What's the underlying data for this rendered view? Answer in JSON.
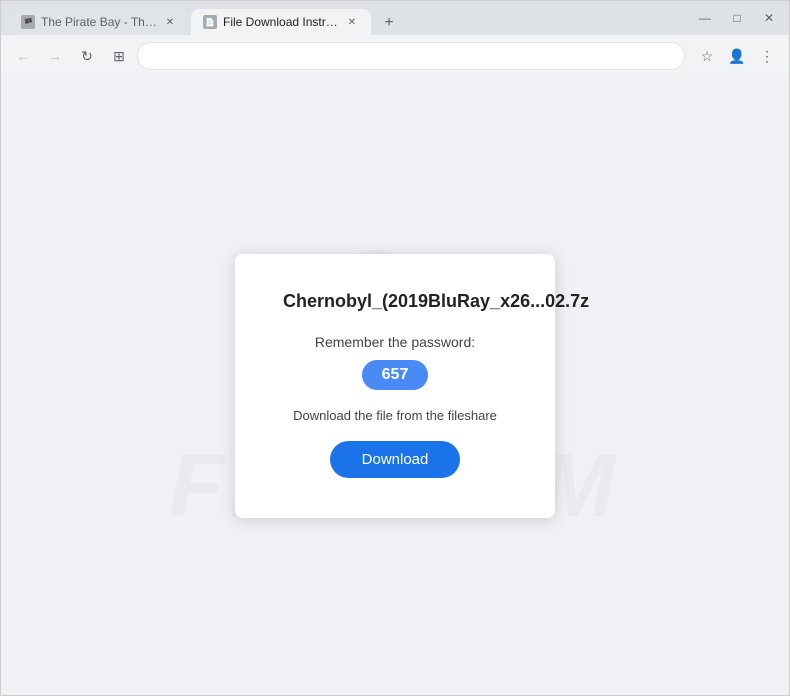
{
  "browser": {
    "tabs": [
      {
        "id": "tab1",
        "label": "The Pirate Bay - The galaxy's m...",
        "favicon": "🏴",
        "active": false
      },
      {
        "id": "tab2",
        "label": "File Download Instructions for...",
        "favicon": "📄",
        "active": true
      }
    ],
    "new_tab_symbol": "+",
    "window_controls": {
      "minimize": "—",
      "maximize": "□",
      "close": "✕"
    },
    "nav": {
      "back": "←",
      "forward": "→",
      "reload": "↻",
      "extensions": "⊞"
    },
    "address": "",
    "bookmark_icon": "☆",
    "profile_icon": "👤",
    "menu_icon": "⋮"
  },
  "page": {
    "card": {
      "title": "Chernobyl_(2019BluRay_x26...02.7z",
      "remember_label": "Remember the password:",
      "password": "657",
      "fileshare_label": "Download the file from the fileshare",
      "download_label": "Download"
    },
    "watermark_text": "FISHKUM"
  },
  "colors": {
    "tab_active_bg": "#f1f3f4",
    "tab_inactive_bg": "#e0e3e8",
    "address_bar_bg": "#fff",
    "page_bg": "#f0f0f5",
    "card_bg": "#ffffff",
    "password_badge_bg": "#4a8af4",
    "download_btn_bg": "#1a73e8"
  }
}
